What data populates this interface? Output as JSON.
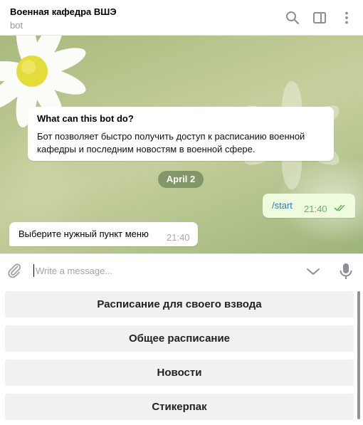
{
  "header": {
    "title": "Военная кафедра ВШЭ",
    "subtitle": "bot",
    "icons": [
      "search-icon",
      "sidebar-toggle-icon",
      "more-vert-icon"
    ]
  },
  "chat": {
    "bot_info": {
      "question": "What can this bot do?",
      "description": "Бот позволяет быстро получить доступ к расписанию военной кафедры и последним новостям в военной сфере."
    },
    "date_label": "April 2",
    "messages": [
      {
        "direction": "out",
        "text": "/start",
        "time": "21:40",
        "status": "read"
      },
      {
        "direction": "in",
        "text": "Выберите нужный пункт меню",
        "time": "21:40"
      }
    ]
  },
  "composer": {
    "placeholder": "Write a message...",
    "value": ""
  },
  "keyboard": {
    "buttons": [
      {
        "label": "Расписание для своего взвода"
      },
      {
        "label": "Общее расписание"
      },
      {
        "label": "Новости"
      },
      {
        "label": "Стикерпак"
      }
    ]
  },
  "colors": {
    "outgoing_bubble": "#effdde",
    "link": "#2a7ab4",
    "read_ticks": "#5fb45b",
    "date_pill": "#6e8658",
    "keyboard_button": "#f0f1f2"
  }
}
